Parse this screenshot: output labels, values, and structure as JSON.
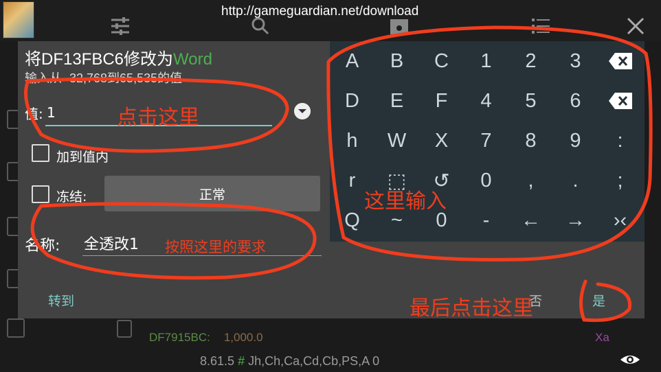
{
  "topbar": {
    "url": "http://gameguardian.net/download",
    "icons": [
      "tune-icon",
      "search-icon",
      "save-icon",
      "list-icon",
      "close-icon"
    ]
  },
  "dialog": {
    "title_prefix": "将DF13FBC6修改为",
    "title_type": "Word",
    "subtitle": "输入从 -32,768到65,535的值",
    "value_label": "值:",
    "value": "1",
    "add_to_value_label": "加到值内",
    "freeze_label": "冻结:",
    "freeze_mode": "正常",
    "name_label": "名称:",
    "name_value": "全透改1",
    "goto_label": "转到",
    "no_label": "否",
    "yes_label": "是"
  },
  "keyboard": {
    "rows": [
      [
        "A",
        "B",
        "C",
        "1",
        "2",
        "3",
        "⌫"
      ],
      [
        "D",
        "E",
        "F",
        "4",
        "5",
        "6",
        "⌫"
      ],
      [
        "h",
        "W",
        "X",
        "7",
        "8",
        "9",
        ":"
      ],
      [
        "r",
        "⬚",
        "↺",
        "0",
        ",",
        ".",
        ";"
      ],
      [
        "Q",
        "~",
        "0",
        "-",
        "←",
        "→",
        "›‹"
      ]
    ]
  },
  "background": {
    "address": "DF7915BC:",
    "value": "1,000.0",
    "type_suffix": "Xa",
    "status_version": "8.61.5",
    "status_hash": "#",
    "status_regions": "Jh,Ch,Ca,Cd,Cb,PS,A 0"
  },
  "annotations": {
    "tap_here": "点击这里",
    "input_here": "这里输入",
    "name_hint": "按照这里的要求",
    "finally_tap": "最后点击这里",
    "color": "#f03d1e"
  }
}
